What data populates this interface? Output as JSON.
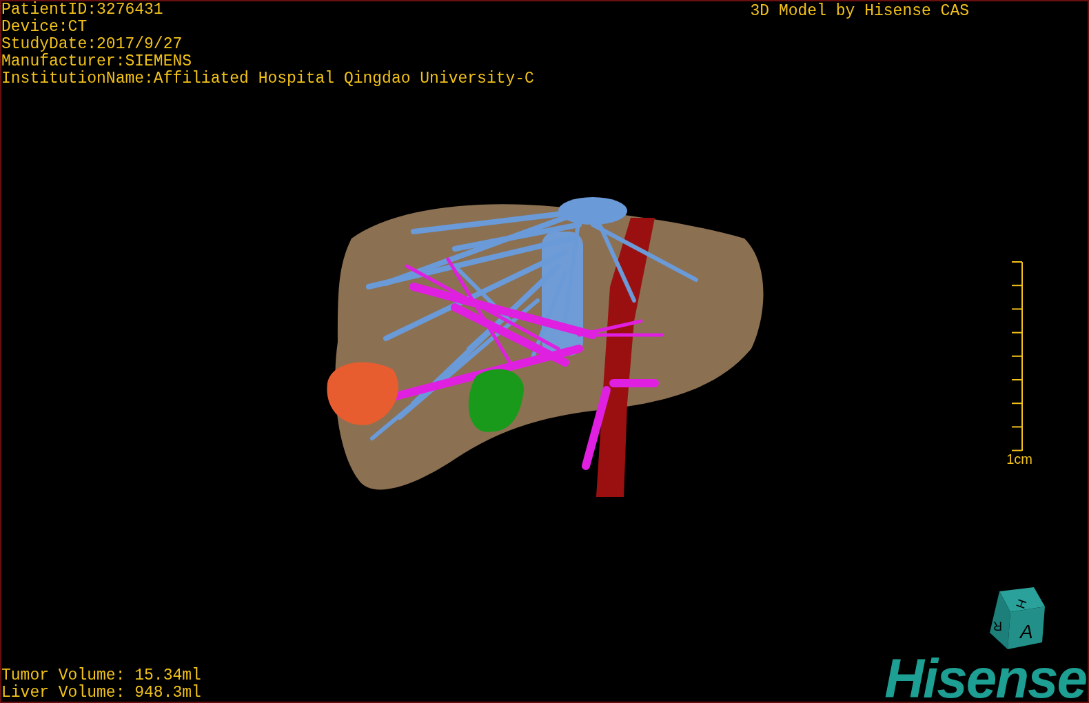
{
  "study_info": [
    "PatientID:3276431",
    "Device:CT",
    "StudyDate:2017/9/27",
    "Manufacturer:SIEMENS",
    "InstitutionName:Affiliated Hospital Qingdao University-C"
  ],
  "title": "3D Model by Hisense CAS",
  "scale_bar": {
    "label": "1cm"
  },
  "volumes": [
    "Tumor Volume: 15.34ml",
    "Liver Volume: 948.3ml"
  ],
  "orientation_cube": {
    "faces": [
      "H",
      "R",
      "A"
    ]
  },
  "logo": "Hisense"
}
